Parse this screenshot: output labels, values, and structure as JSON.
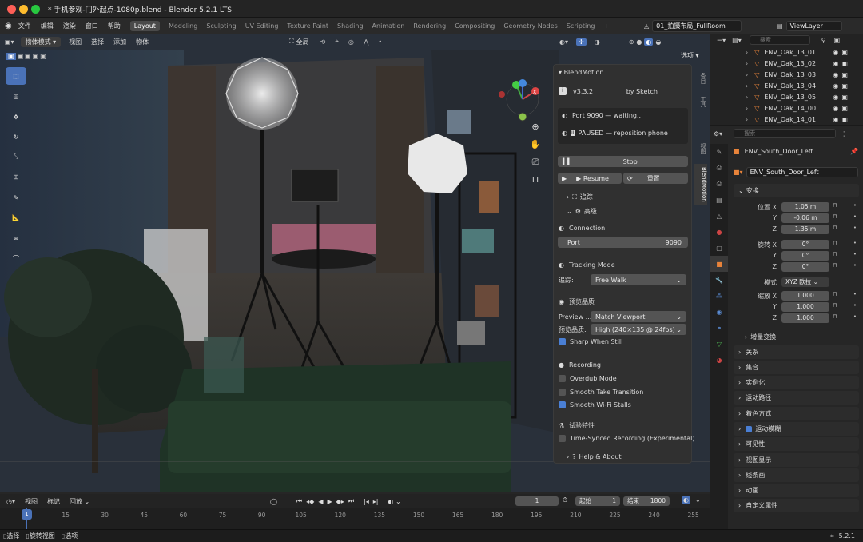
{
  "window": {
    "title": "* 手机参观-门外起点-1080p.blend - Blender 5.2.1 LTS"
  },
  "menu": {
    "items": [
      "文件",
      "编辑",
      "渲染",
      "窗口",
      "帮助"
    ]
  },
  "workspaces": [
    "Layout",
    "Modeling",
    "Sculpting",
    "UV Editing",
    "Texture Paint",
    "Shading",
    "Animation",
    "Rendering",
    "Compositing",
    "Geometry Nodes",
    "Scripting"
  ],
  "scene": {
    "name": "01_拍摄布局_FullRoom",
    "view_layer": "ViewLayer"
  },
  "viewport_header": {
    "mode": "物体模式",
    "menus": [
      "视图",
      "选择",
      "添加",
      "物体"
    ],
    "transform_orientation": "全局",
    "options_label": "选项"
  },
  "npanel": {
    "title": "BlendMotion",
    "version": "v3.3.2",
    "author": "by Sketch",
    "port_status": "Port 9090 — waiting...",
    "paused_status": "PAUSED — reposition phone",
    "stop_label": "Stop",
    "resume_label": "Resume",
    "reset_label": "重置",
    "tracking_label": "追踪",
    "advanced_label": "高级",
    "connection_title": "Connection",
    "port_label": "Port",
    "port_value": "9090",
    "tracking_mode_title": "Tracking Mode",
    "track_label": "追踪:",
    "track_value": "Free Walk",
    "preview_quality_title": "预览品质",
    "preview_label": "Preview ...",
    "preview_value": "Match Viewport",
    "quality_label": "预览品质:",
    "quality_value": "High (240×135 @ 24fps)",
    "sharp_label": "Sharp When Still",
    "recording_title": "Recording",
    "overdub_label": "Overdub Mode",
    "smooth_take_label": "Smooth Take Transition",
    "smooth_wifi_label": "Smooth Wi-Fi Stalls",
    "experimental_title": "试验特性",
    "timesync_label": "Time-Synced Recording (Experimental)",
    "help_label": "Help & About"
  },
  "sidebar_tabs": [
    "条目",
    "工具",
    "视图",
    "BlendMotion"
  ],
  "outliner": {
    "search_placeholder": "搜索",
    "items": [
      "ENV_Oak_13_01",
      "ENV_Oak_13_02",
      "ENV_Oak_13_03",
      "ENV_Oak_13_04",
      "ENV_Oak_13_05",
      "ENV_Oak_14_00",
      "ENV_Oak_14_01"
    ]
  },
  "properties": {
    "search_placeholder": "搜索",
    "object_name": "ENV_South_Door_Left",
    "object_data_name": "ENV_South_Door_Left",
    "transform_title": "变换",
    "loc_label": "位置 X",
    "y_label": "Y",
    "z_label": "Z",
    "x_label": "X",
    "loc": [
      "1.05 m",
      "-0.06 m",
      "1.35 m"
    ],
    "rot_label": "旋转 X",
    "rot": [
      "0°",
      "0°",
      "0°"
    ],
    "mode_label": "模式",
    "mode_value": "XYZ 欧拉",
    "scale_label": "缩放 X",
    "scale": [
      "1.000",
      "1.000",
      "1.000"
    ],
    "delta_label": "增量变换",
    "sections": [
      "关系",
      "集合",
      "实例化",
      "运动路径",
      "着色方式",
      "运动模糊",
      "可见性",
      "视图显示",
      "线条画",
      "动画",
      "自定义属性"
    ]
  },
  "timeline": {
    "menus": [
      "视图",
      "标记",
      "回放"
    ],
    "current_frame": "1",
    "start_label": "起始",
    "start_value": "1",
    "end_label": "结束",
    "end_value": "1800",
    "ticks": [
      "1",
      "15",
      "30",
      "45",
      "60",
      "75",
      "90",
      "105",
      "120",
      "135",
      "150",
      "165",
      "180",
      "195",
      "210",
      "225",
      "240",
      "255"
    ]
  },
  "statusbar": {
    "select": "选择",
    "rotate": "旋转视图",
    "options": "选项",
    "version": "5.2.1"
  }
}
